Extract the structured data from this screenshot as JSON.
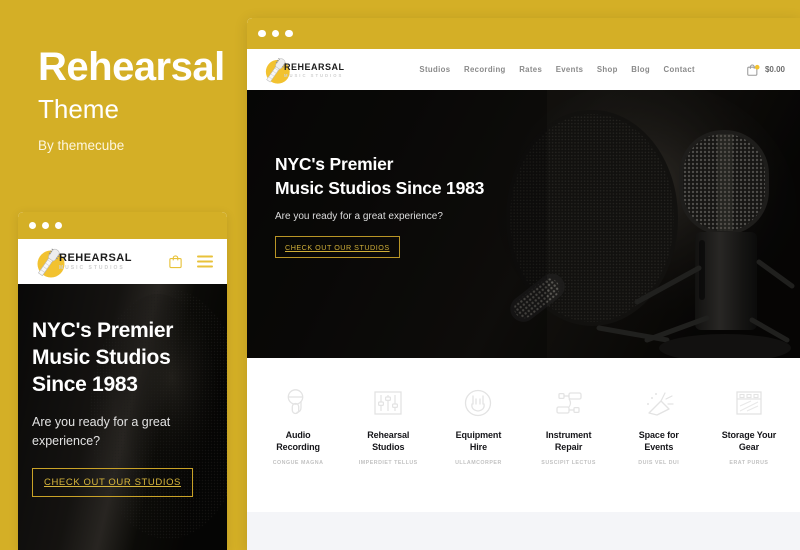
{
  "promo": {
    "title": "Rehearsal",
    "subtitle": "Theme",
    "author": "By themecube"
  },
  "brand": {
    "accent_gold": "#D4AF26",
    "name": "REHEARSAL",
    "tagline": "MUSIC STUDIOS"
  },
  "desktop_window": {
    "header": {
      "nav": [
        {
          "label": "Studios"
        },
        {
          "label": "Recording"
        },
        {
          "label": "Rates"
        },
        {
          "label": "Events"
        },
        {
          "label": "Shop"
        },
        {
          "label": "Blog"
        },
        {
          "label": "Contact"
        }
      ],
      "cart": {
        "icon": "shopping-bag-icon",
        "price": "$0.00"
      }
    },
    "hero": {
      "line1": "NYC's Premier",
      "line2": "Music Studios Since 1983",
      "subtitle": "Are you ready for a great experience?",
      "cta": "CHECK OUT OUR STUDIOS"
    },
    "services": [
      {
        "icon": "microphone-icon",
        "title_line1": "Audio",
        "title_line2": "Recording",
        "subtitle": "CONGUE MAGNA"
      },
      {
        "icon": "mixer-sliders-icon",
        "title_line1": "Rehearsal",
        "title_line2": "Studios",
        "subtitle": "IMPERDIET TELLUS"
      },
      {
        "icon": "rock-hand-icon",
        "title_line1": "Equipment",
        "title_line2": "Hire",
        "subtitle": "ULLAMCORPER"
      },
      {
        "icon": "cable-connector-icon",
        "title_line1": "Instrument",
        "title_line2": "Repair",
        "subtitle": "SUSCIPIT LECTUS"
      },
      {
        "icon": "confetti-popper-icon",
        "title_line1": "Space for",
        "title_line2": "Events",
        "subtitle": "DUIS VEL DUI"
      },
      {
        "icon": "storage-locker-icon",
        "title_line1": "Storage Your",
        "title_line2": "Gear",
        "subtitle": "ERAT PURUS"
      }
    ]
  },
  "mobile_window": {
    "header": {
      "cart_icon": "shopping-bag-icon",
      "menu_icon": "hamburger-menu-icon"
    },
    "hero": {
      "line1": "NYC's Premier",
      "line2": "Music Studios",
      "line3": "Since 1983",
      "subtitle": "Are you ready for a great experience?",
      "cta": "CHECK OUT OUR STUDIOS"
    }
  }
}
